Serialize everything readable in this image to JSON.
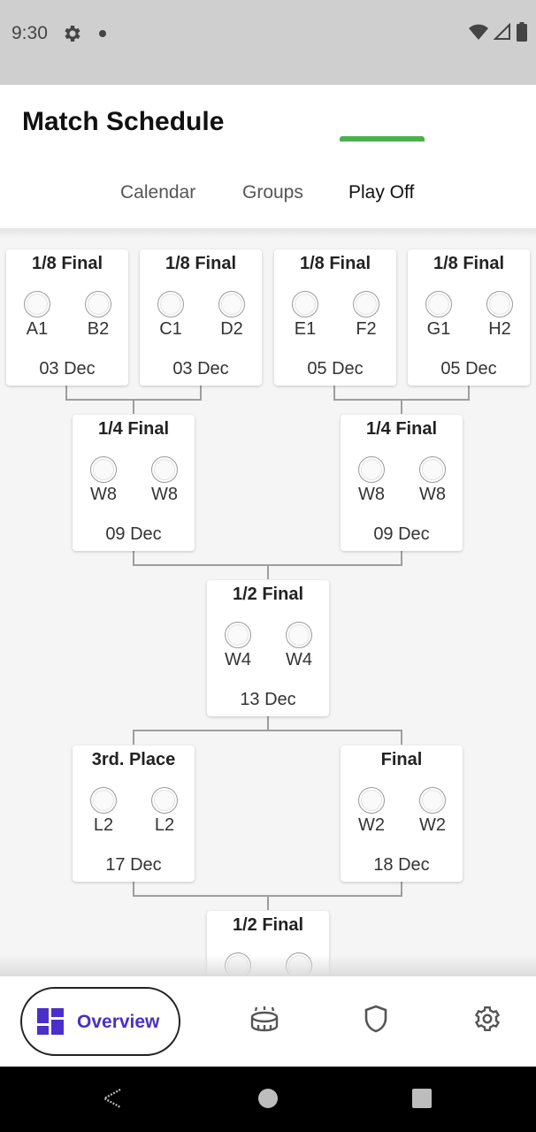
{
  "status_bar": {
    "time": "9:30"
  },
  "header": {
    "title": "Match Schedule"
  },
  "tabs": [
    {
      "label": "Calendar"
    },
    {
      "label": "Groups"
    },
    {
      "label": "Play Off"
    }
  ],
  "active_tab": "Play Off",
  "matches": [
    {
      "title": "1/8 Final",
      "team1": "A1",
      "team2": "B2",
      "date": "03 Dec"
    },
    {
      "title": "1/8 Final",
      "team1": "C1",
      "team2": "D2",
      "date": "03 Dec"
    },
    {
      "title": "1/8 Final",
      "team1": "E1",
      "team2": "F2",
      "date": "05 Dec"
    },
    {
      "title": "1/8 Final",
      "team1": "G1",
      "team2": "H2",
      "date": "05 Dec"
    },
    {
      "title": "1/4 Final",
      "team1": "W8",
      "team2": "W8",
      "date": "09 Dec"
    },
    {
      "title": "1/4 Final",
      "team1": "W8",
      "team2": "W8",
      "date": "09 Dec"
    },
    {
      "title": "1/2 Final",
      "team1": "W4",
      "team2": "W4",
      "date": "13 Dec"
    },
    {
      "title": "3rd. Place",
      "team1": "L2",
      "team2": "L2",
      "date": "17 Dec"
    },
    {
      "title": "Final",
      "team1": "W2",
      "team2": "W2",
      "date": "18 Dec"
    },
    {
      "title": "1/2 Final",
      "team1": "",
      "team2": "",
      "date": ""
    }
  ],
  "bottom_nav": {
    "overview_label": "Overview",
    "items": [
      {
        "icon": "stadium-icon"
      },
      {
        "icon": "shield-icon"
      },
      {
        "icon": "settings-gear-icon"
      }
    ]
  },
  "colors": {
    "accent_green": "#4caf50",
    "nav_purple": "#4a2fc9"
  }
}
